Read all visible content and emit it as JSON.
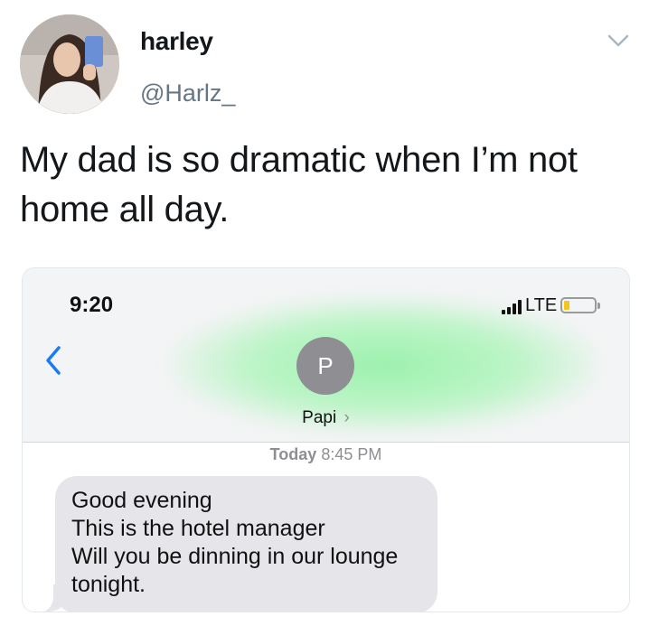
{
  "tweet": {
    "display_name": "harley",
    "handle": "@Harlz_",
    "text": "My dad is so dramatic when I’m not home all day.",
    "more_icon": "chevron-down-icon"
  },
  "screenshot": {
    "status_bar": {
      "time": "9:20",
      "network": "LTE",
      "battery_color": "#f5c518"
    },
    "contact": {
      "initial": "P",
      "name": "Papi",
      "chevron": "›"
    },
    "timestamp": {
      "day": "Today",
      "time": "8:45 PM"
    },
    "message": {
      "lines": [
        "Good evening",
        "This is the hotel manager",
        "Will you be dinning in our lounge",
        "tonight."
      ]
    }
  }
}
